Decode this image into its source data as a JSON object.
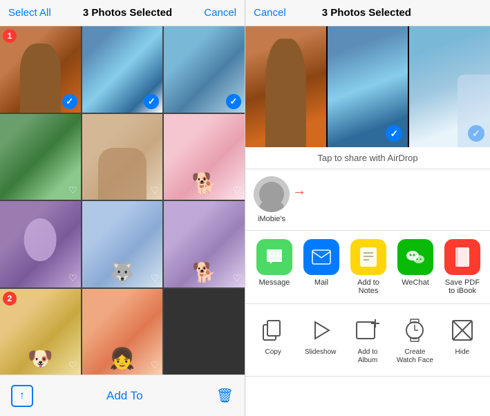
{
  "left": {
    "select_all_label": "Select All",
    "photos_selected_label": "3 Photos Selected",
    "cancel_label": "Cancel",
    "add_to_label": "Add To",
    "badge_1": "1",
    "badge_2": "2",
    "photos": [
      {
        "id": 1,
        "selected": true,
        "badge": "1"
      },
      {
        "id": 2,
        "selected": true,
        "badge": null
      },
      {
        "id": 3,
        "selected": true,
        "badge": null
      },
      {
        "id": 4,
        "selected": false,
        "badge": null
      },
      {
        "id": 5,
        "selected": false,
        "badge": null
      },
      {
        "id": 6,
        "selected": false,
        "badge": null
      },
      {
        "id": 7,
        "selected": false,
        "badge": null
      },
      {
        "id": 8,
        "selected": false,
        "badge": null
      },
      {
        "id": 9,
        "selected": false,
        "badge": null
      },
      {
        "id": 10,
        "selected": false,
        "badge": null
      },
      {
        "id": 11,
        "selected": false,
        "badge": null
      },
      {
        "id": 12,
        "selected": false,
        "badge": null
      }
    ]
  },
  "right": {
    "cancel_label": "Cancel",
    "photos_selected_label": "3 Photos Selected",
    "airdrop_hint": "Tap to share with AirDrop",
    "person_name": "iMobie's",
    "share_actions": [
      {
        "id": "message",
        "label": "Message",
        "icon": "💬"
      },
      {
        "id": "mail",
        "label": "Mail",
        "icon": "✉️"
      },
      {
        "id": "notes",
        "label": "Add to Notes",
        "icon": "📝"
      },
      {
        "id": "wechat",
        "label": "WeChat",
        "icon": "💬"
      },
      {
        "id": "ibooks",
        "label": "Save PDF to iBook",
        "icon": "📖"
      }
    ],
    "secondary_actions": [
      {
        "id": "copy",
        "label": "Copy"
      },
      {
        "id": "slideshow",
        "label": "Slideshow"
      },
      {
        "id": "add-album",
        "label": "Add to Album"
      },
      {
        "id": "watchface",
        "label": "Create Watch Face"
      },
      {
        "id": "hide",
        "label": "Hide"
      }
    ]
  },
  "colors": {
    "ios_blue": "#007aff",
    "ios_green": "#4cd964",
    "ios_red": "#ff3b30",
    "ios_yellow": "#ffd60a"
  }
}
